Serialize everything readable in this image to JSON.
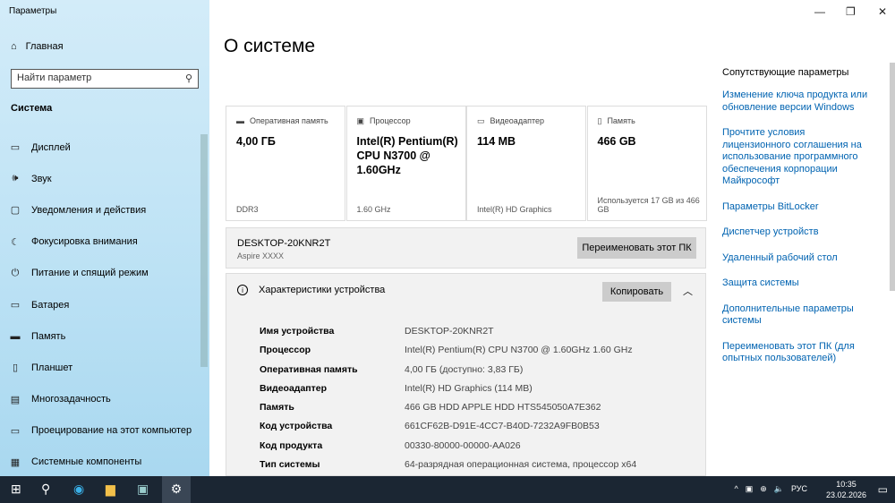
{
  "window": {
    "title": "Параметры"
  },
  "sidebar": {
    "home": "Главная",
    "search_placeholder": "Найти параметр",
    "section": "Система",
    "items": [
      {
        "label": "Дисплей",
        "icon": "display-icon"
      },
      {
        "label": "Звук",
        "icon": "sound-icon"
      },
      {
        "label": "Уведомления и действия",
        "icon": "notifications-icon"
      },
      {
        "label": "Фокусировка внимания",
        "icon": "focus-icon"
      },
      {
        "label": "Питание и спящий режим",
        "icon": "power-icon"
      },
      {
        "label": "Батарея",
        "icon": "battery-icon"
      },
      {
        "label": "Память",
        "icon": "storage-icon"
      },
      {
        "label": "Планшет",
        "icon": "tablet-icon"
      },
      {
        "label": "Многозадачность",
        "icon": "multitask-icon"
      },
      {
        "label": "Проецирование на этот компьютер",
        "icon": "project-icon"
      },
      {
        "label": "Системные компоненты",
        "icon": "components-icon"
      }
    ]
  },
  "main": {
    "title": "О системе",
    "cards": [
      {
        "label": "Оперативная память",
        "value": "4,00 ГБ",
        "sub": "DDR3"
      },
      {
        "label": "Процессор",
        "value": "Intel(R) Pentium(R) CPU  N3700  @ 1.60GHz",
        "sub": "1.60 GHz"
      },
      {
        "label": "Видеоадаптер",
        "value": "114 MB",
        "sub": "Intel(R) HD Graphics"
      },
      {
        "label": "Память",
        "value": "466 GB",
        "sub": "Используется 17 GB из 466 GB"
      }
    ],
    "pc": {
      "name": "DESKTOP-20KNR2T",
      "model": "Aspire XXXX",
      "rename": "Переименовать этот ПК"
    },
    "specs": {
      "title": "Характеристики устройства",
      "copy": "Копировать",
      "rows": [
        {
          "k": "Имя устройства",
          "v": "DESKTOP-20KNR2T"
        },
        {
          "k": "Процессор",
          "v": "Intel(R) Pentium(R) CPU  N3700  @ 1.60GHz   1.60 GHz"
        },
        {
          "k": "Оперативная память",
          "v": "4,00 ГБ (доступно: 3,83 ГБ)"
        },
        {
          "k": "Видеоадаптер",
          "v": "Intel(R) HD Graphics (114 MB)"
        },
        {
          "k": "Память",
          "v": "466 GB HDD APPLE HDD HTS545050A7E362"
        },
        {
          "k": "Код устройства",
          "v": "661CF62B-D91E-4CC7-B40D-7232A9FB0B53"
        },
        {
          "k": "Код продукта",
          "v": "00330-80000-00000-AA026"
        },
        {
          "k": "Тип системы",
          "v": "64-разрядная операционная система, процессор x64"
        }
      ]
    }
  },
  "related": {
    "title": "Сопутствующие параметры",
    "links": [
      "Изменение ключа продукта или обновление версии Windows",
      "Прочтите условия лицензионного соглашения на использование программного обеспечения корпорации Майкрософт",
      "Параметры BitLocker",
      "Диспетчер устройств",
      "Удаленный рабочий стол",
      "Защита системы",
      "Дополнительные параметры системы",
      "Переименовать этот ПК (для опытных пользователей)"
    ]
  },
  "taskbar": {
    "lang": "РУС",
    "time": "10:35",
    "date": "23.02.2026"
  }
}
